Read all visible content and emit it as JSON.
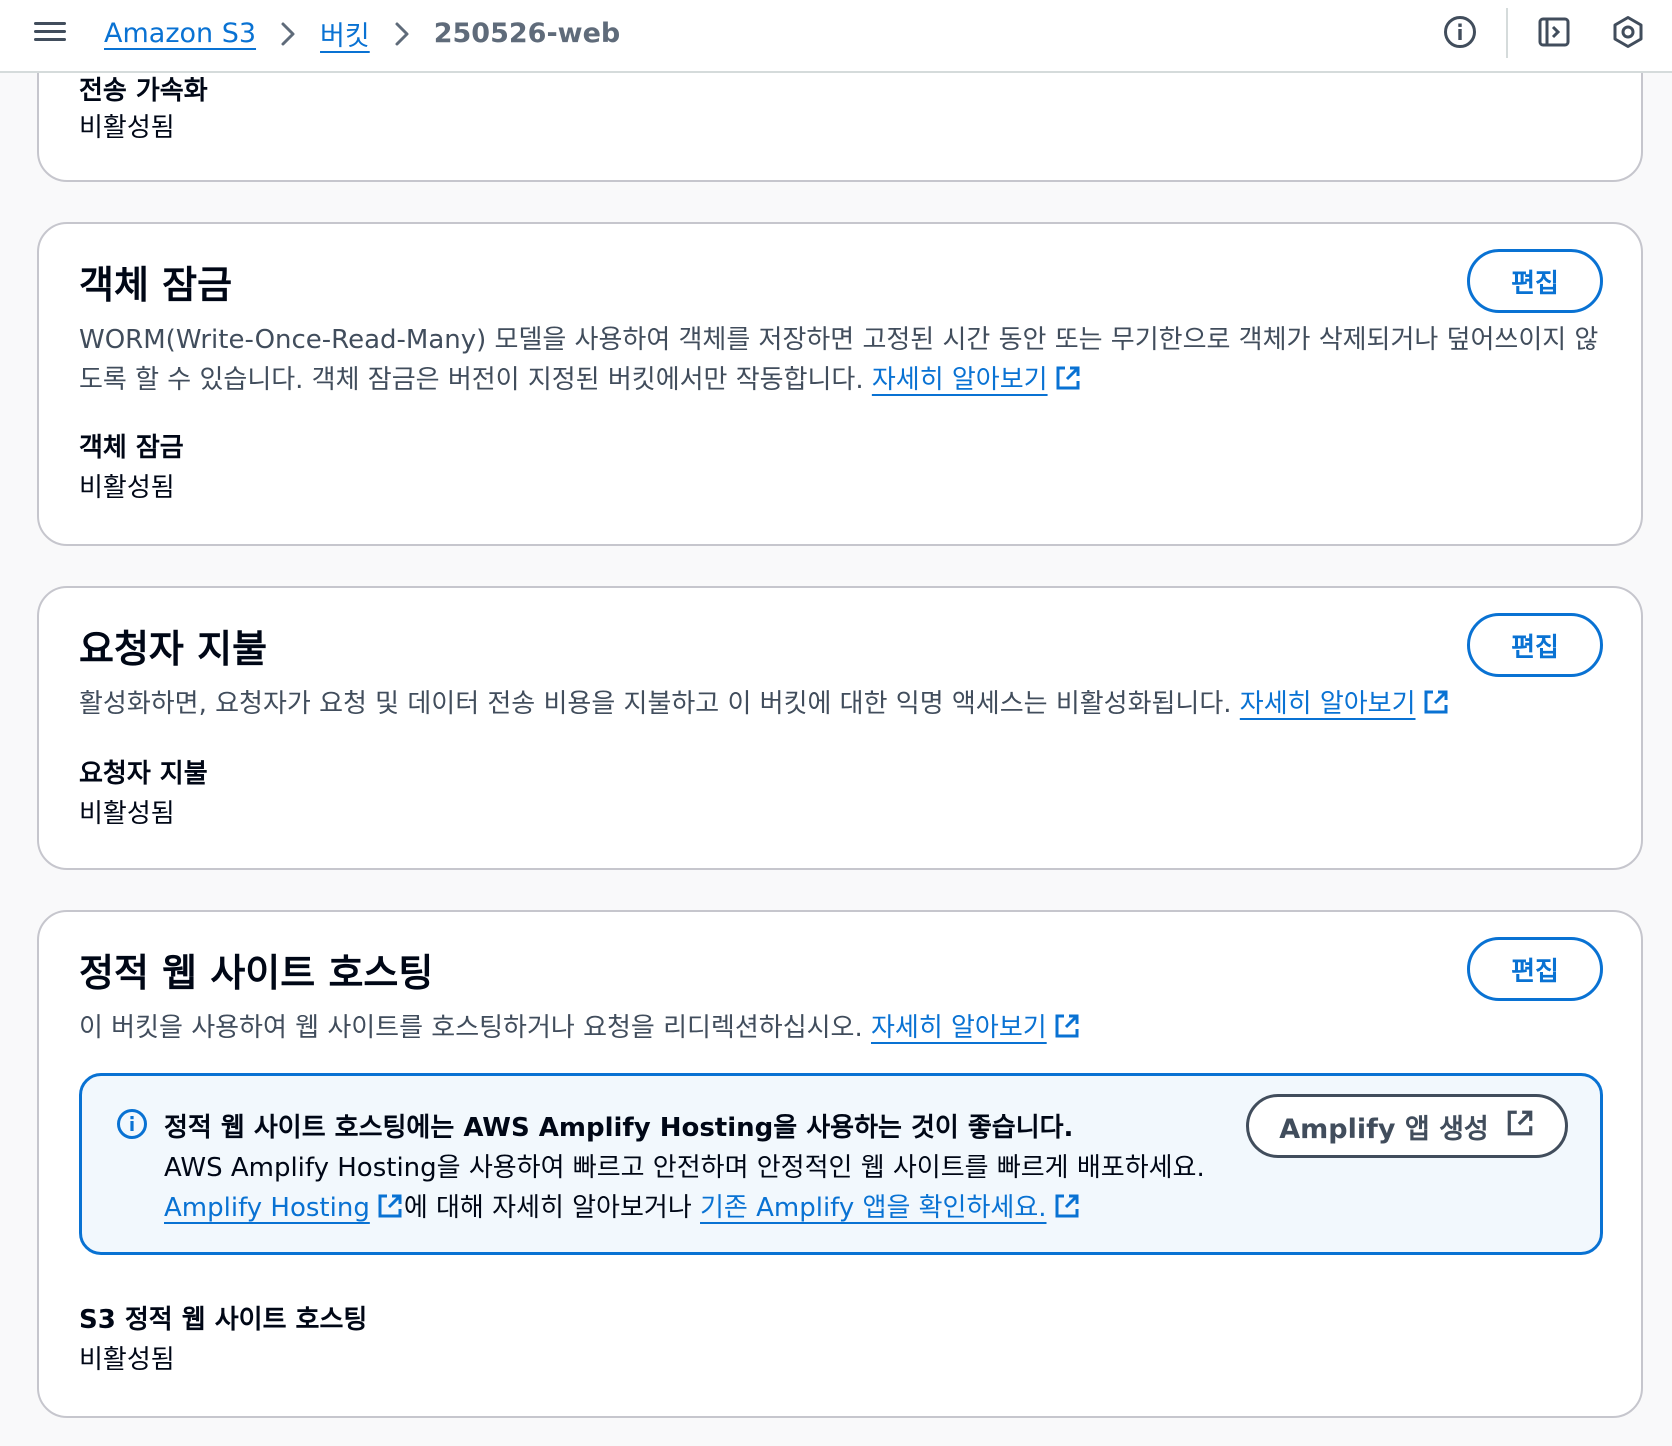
{
  "header": {
    "breadcrumb": [
      "Amazon S3",
      "버킷",
      "250526-web"
    ]
  },
  "icons": {
    "menu": "hamburger-menu-icon",
    "info": "info-circle-icon",
    "notifications": "side-panel-icon",
    "settings": "settings-hexagon-icon",
    "external": "external-link-icon"
  },
  "transfer_acceleration": {
    "title_partial": "전송 가속화",
    "value": "비활성됨"
  },
  "object_lock": {
    "title": "객체 잠금",
    "edit_label": "편집",
    "desc_line1": "WORM(Write-Once-Read-Many) 모델을 사용하여 객체를 저장하면 고정된 시간 동안 또는 무기한으로 객체가 삭제되거나 덮어쓰이지 않",
    "desc_line2": "도록 할 수 있습니다. 객체 잠금은 버전이 지정된 버킷에서만 작동합니다.",
    "learn_more": "자세히 알아보기",
    "field_label": "객체 잠금",
    "field_value": "비활성됨"
  },
  "requester_pays": {
    "title": "요청자 지불",
    "edit_label": "편집",
    "desc": "활성화하면, 요청자가 요청 및 데이터 전송 비용을 지불하고 이 버킷에 대한 익명 액세스는 비활성화됩니다.",
    "learn_more": "자세히 알아보기",
    "field_label": "요청자 지불",
    "field_value": "비활성됨"
  },
  "static_hosting": {
    "title": "정적 웹 사이트 호스팅",
    "edit_label": "편집",
    "desc": "이 버킷을 사용하여 웹 사이트를 호스팅하거나 요청을 리디렉션하십시오.",
    "learn_more": "자세히 알아보기",
    "info": {
      "heading": "정적 웹 사이트 호스팅에는 AWS Amplify Hosting을 사용하는 것이 좋습니다.",
      "line2": "AWS Amplify Hosting을 사용하여 빠르고 안전하며 안정적인 웹 사이트를 빠르게 배포하세요.",
      "link1": "Amplify Hosting",
      "mid_text": "에 대해 자세히 알아보거나",
      "link2": "기존 Amplify 앱을 확인하세요.",
      "button_label": "Amplify 앱 생성"
    },
    "field_label": "S3 정적 웹 사이트 호스팅",
    "field_value": "비활성됨"
  },
  "colors": {
    "link": "#0972d3",
    "info_bg": "#f2f8fd",
    "border": "#c6c6cd"
  }
}
